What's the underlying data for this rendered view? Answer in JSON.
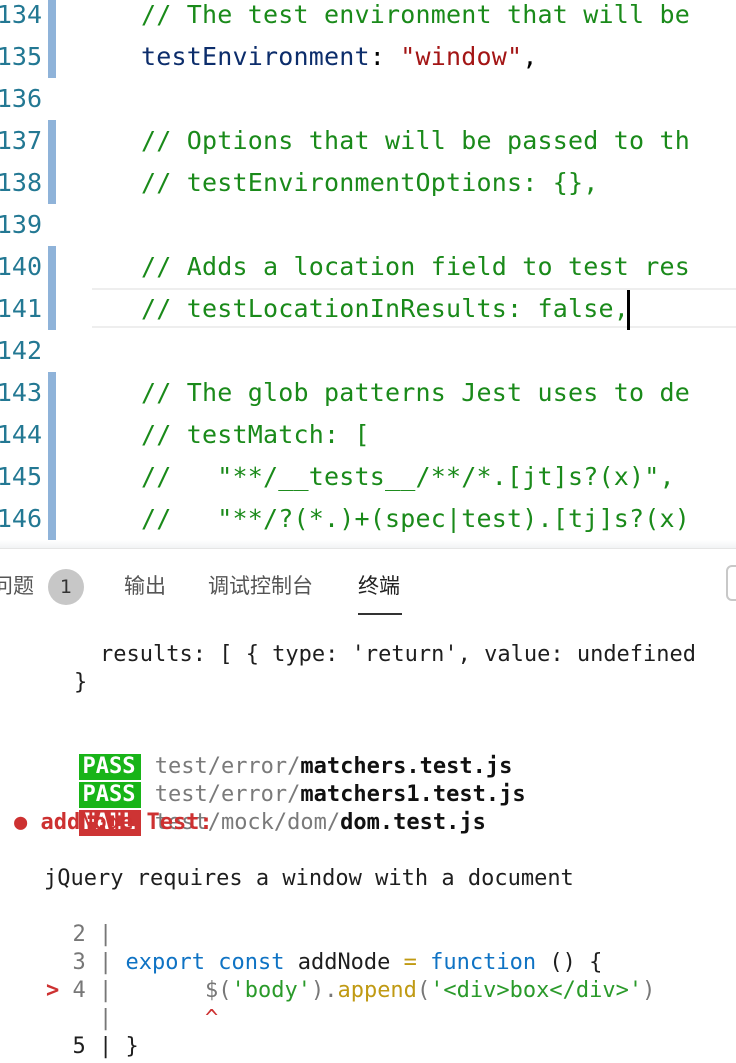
{
  "editor": {
    "lines": [
      {
        "num": "134",
        "segments": [
          {
            "text": "// The test environment that will be",
            "cls": "cmt"
          }
        ]
      },
      {
        "num": "135",
        "segments": [
          {
            "text": "testEnvironment",
            "cls": "prop"
          },
          {
            "text": ": ",
            "cls": "pun"
          },
          {
            "text": "\"window\"",
            "cls": "str"
          },
          {
            "text": ",",
            "cls": "pun"
          }
        ]
      },
      {
        "num": "136",
        "segments": []
      },
      {
        "num": "137",
        "segments": [
          {
            "text": "// Options that will be passed to th",
            "cls": "cmt"
          }
        ]
      },
      {
        "num": "138",
        "segments": [
          {
            "text": "// testEnvironmentOptions: {},",
            "cls": "cmt"
          }
        ]
      },
      {
        "num": "139",
        "segments": []
      },
      {
        "num": "140",
        "segments": [
          {
            "text": "// Adds a location field to test res",
            "cls": "cmt"
          }
        ]
      },
      {
        "num": "141",
        "segments": [
          {
            "text": "// testLocationInResults: false,",
            "cls": "cmt"
          }
        ]
      },
      {
        "num": "142",
        "segments": []
      },
      {
        "num": "143",
        "segments": [
          {
            "text": "// The glob patterns Jest uses to de",
            "cls": "cmt"
          }
        ]
      },
      {
        "num": "144",
        "segments": [
          {
            "text": "// testMatch: [",
            "cls": "cmt"
          }
        ]
      },
      {
        "num": "145",
        "segments": [
          {
            "text": "//   \"**/__tests__/**/*.[jt]s?(x)\",",
            "cls": "cmt"
          }
        ]
      },
      {
        "num": "146",
        "segments": [
          {
            "text": "//   \"**/?(*.)+(spec|test).[tj]s?(x)",
            "cls": "cmt"
          }
        ]
      }
    ],
    "modified_lines": [
      "134",
      "135",
      "137",
      "138",
      "140",
      "141",
      "143",
      "144",
      "145",
      "146"
    ]
  },
  "panel": {
    "tabs": [
      {
        "label": "问题",
        "name": "tab-problems"
      },
      {
        "label": "输出",
        "name": "tab-output"
      },
      {
        "label": "调试控制台",
        "name": "tab-debug-console"
      },
      {
        "label": "终端",
        "name": "tab-terminal"
      }
    ],
    "active_tab": "终端",
    "problems_count": "1"
  },
  "terminal": {
    "results_line": "results: [ { type: 'return', value: undefined",
    "closing_brace": "}",
    "runs": [
      {
        "status": "PASS",
        "path": "test/error/",
        "file": "matchers.test.js"
      },
      {
        "status": "PASS",
        "path": "test/error/",
        "file": "matchers1.test.js"
      },
      {
        "status": "FAIL",
        "path": "test/mock/dom/",
        "file": "dom.test.js"
      }
    ],
    "failed_test": "● addNode Test:",
    "error_message": "jQuery requires a window with a document",
    "snippet": {
      "l2": "  2 |",
      "l3_num": "  3 | ",
      "l3_export": "export",
      "l3_const": "const",
      "l3_name": "addNode",
      "l3_eq": "=",
      "l3_function": "function",
      "l3_rest": "() {",
      "l4_marker": "> ",
      "l4_num": "4 |",
      "l4_dollar": "$(",
      "l4_body": "'body'",
      "l4_close": ").",
      "l4_append": "append",
      "l4_open": "(",
      "l4_arg": "'<div>box</div>'",
      "l4_end": ")",
      "caret_bar": "    |",
      "caret": "^",
      "l5": "  5 | }"
    }
  }
}
